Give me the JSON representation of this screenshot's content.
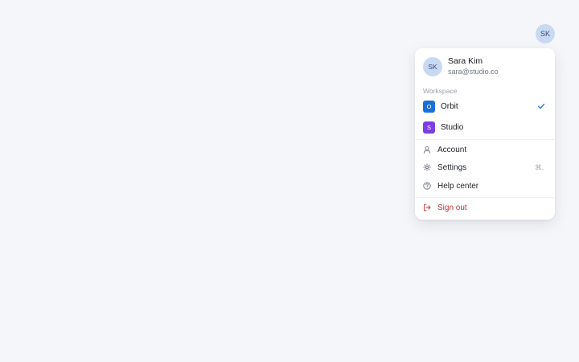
{
  "trigger": {
    "initials": "SK"
  },
  "profile": {
    "initials": "SK",
    "name": "Sara Kim",
    "email": "sara@studio.co"
  },
  "workspace": {
    "section_label": "Workspace",
    "items": [
      {
        "badge": "O",
        "label": "Orbit",
        "color": "#1d6fd8",
        "selected": true
      },
      {
        "badge": "S",
        "label": "Studio",
        "color": "#7b3fe4",
        "selected": false
      }
    ]
  },
  "menu": {
    "account_label": "Account",
    "settings_label": "Settings",
    "settings_shortcut": "⌘,",
    "help_label": "Help center",
    "signout_label": "Sign out"
  },
  "colors": {
    "accent": "#1d6fd8",
    "danger": "#c2343a"
  }
}
